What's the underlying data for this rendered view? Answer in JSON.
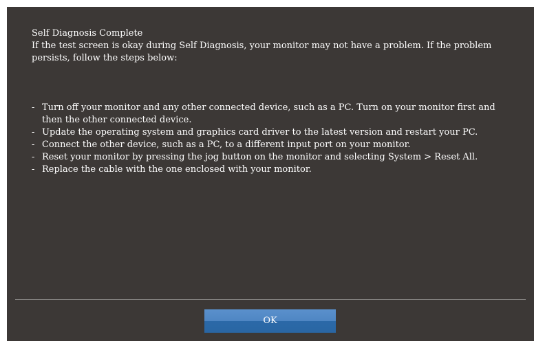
{
  "dialog": {
    "title": "Self Diagnosis Complete",
    "intro": "If the test screen is okay during Self Diagnosis, your monitor may not have a problem. If the problem persists, follow the steps below:",
    "step_bullet": "-",
    "steps": [
      "Turn off your monitor and any other connected device, such as a PC. Turn on your monitor first and then the other connected device.",
      "Update the operating system and graphics card driver to the latest version and restart your PC.",
      "Connect the other device, such as a PC, to a different input port on your monitor.",
      "Reset your monitor by pressing the jog button on the monitor and selecting System > Reset All.",
      "Replace the cable with the one enclosed with your monitor."
    ],
    "ok_label": "OK"
  },
  "colors": {
    "panel_background": "#3c3836",
    "text": "#ffffff",
    "divider": "#8c8a88",
    "button_top": "#5a90cc",
    "button_bottom": "#2b69a8"
  }
}
